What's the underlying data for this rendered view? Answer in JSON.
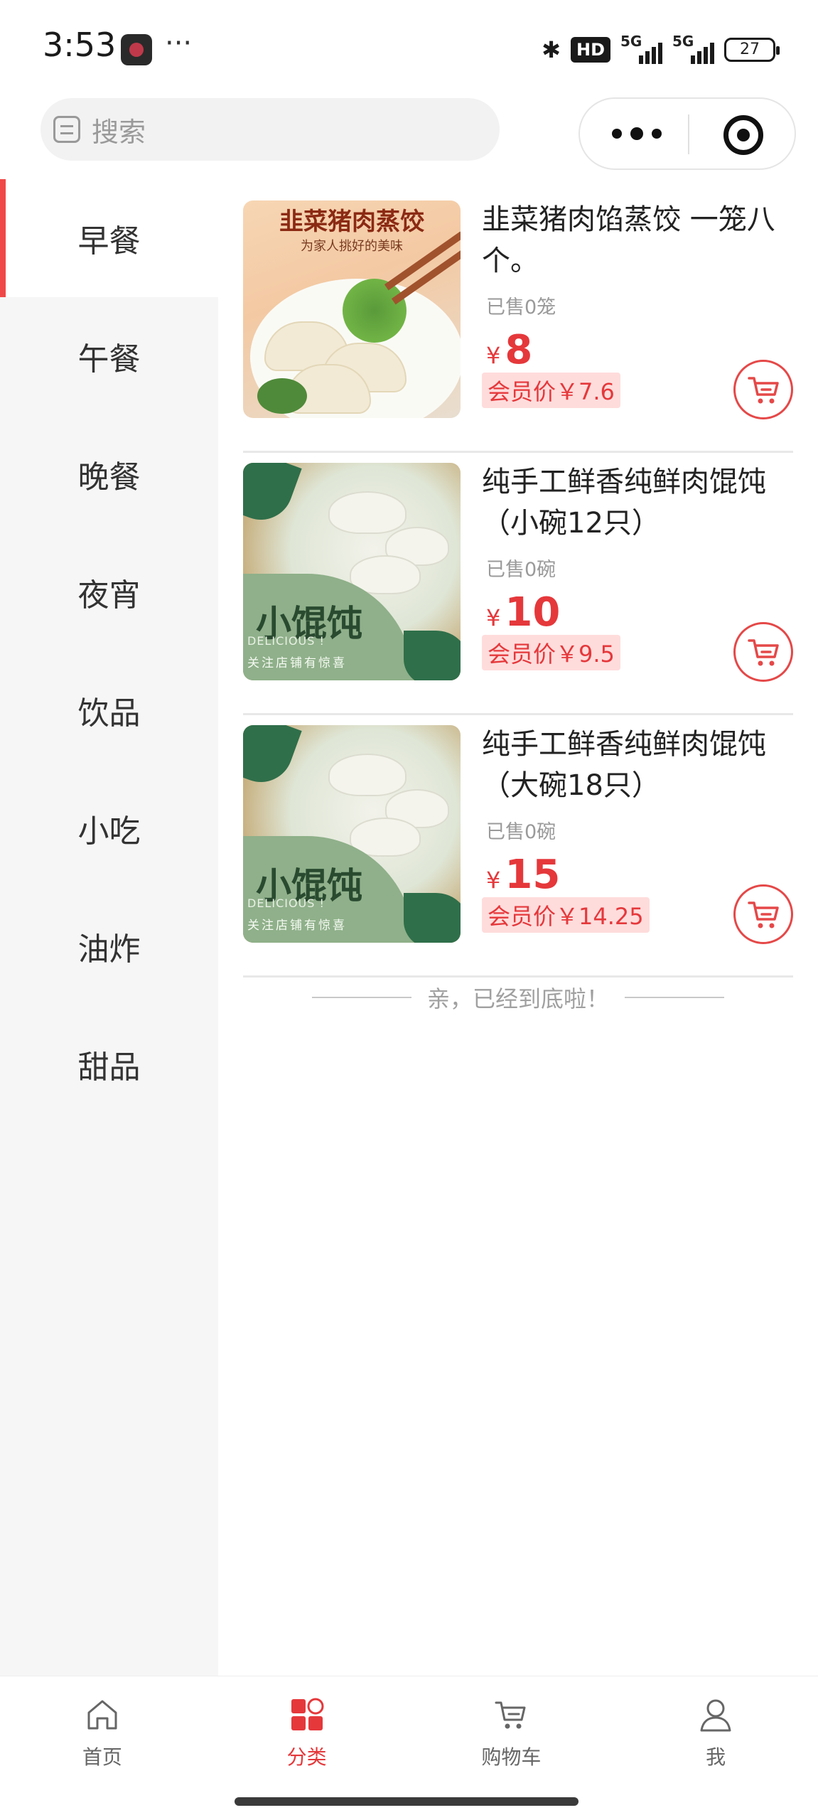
{
  "status_bar": {
    "time": "3:53",
    "dots": "···",
    "hd_badge": "HD",
    "signal1_label": "5G",
    "signal2_label": "5G",
    "battery": "27"
  },
  "search": {
    "placeholder": "搜索"
  },
  "sidebar": {
    "items": [
      {
        "label": "早餐",
        "active": true
      },
      {
        "label": "午餐"
      },
      {
        "label": "晚餐"
      },
      {
        "label": "夜宵"
      },
      {
        "label": "饮品"
      },
      {
        "label": "小吃"
      },
      {
        "label": "油炸"
      },
      {
        "label": "甜品"
      }
    ]
  },
  "products": [
    {
      "name": "韭菜猪肉馅蒸饺 一笼八个。",
      "sold": "已售0笼",
      "currency": "¥",
      "price": "8",
      "member_price": "会员价￥7.6",
      "image_title": "韭菜猪肉蒸饺",
      "image_subtitle": "为家人挑好的美味"
    },
    {
      "name": "纯手工鲜香纯鲜肉馄饨（小碗12只）",
      "sold": "已售0碗",
      "currency": "¥",
      "price": "10",
      "member_price": "会员价￥9.5",
      "image_title": "小馄饨",
      "image_subtitle": "DELICIOUS !",
      "image_note": "关注店铺有惊喜"
    },
    {
      "name": "纯手工鲜香纯鲜肉馄饨（大碗18只）",
      "sold": "已售0碗",
      "currency": "¥",
      "price": "15",
      "member_price": "会员价￥14.25",
      "image_title": "小馄饨",
      "image_subtitle": "DELICIOUS !",
      "image_note": "关注店铺有惊喜"
    }
  ],
  "list_end": "亲，已经到底啦！",
  "tabbar": {
    "items": [
      {
        "label": "首页",
        "icon": "home-icon"
      },
      {
        "label": "分类",
        "icon": "category-icon",
        "active": true
      },
      {
        "label": "购物车",
        "icon": "cart-icon"
      },
      {
        "label": "我",
        "icon": "user-icon"
      }
    ]
  },
  "colors": {
    "accent": "#e5383b",
    "sidebar_bg": "#f6f6f6",
    "member_bg": "#ffdcdc"
  }
}
